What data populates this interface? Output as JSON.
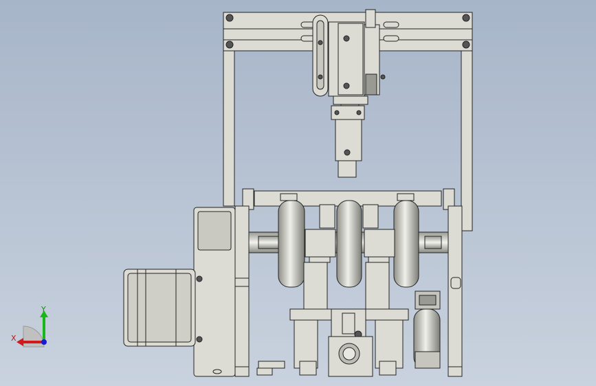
{
  "viewport": {
    "background_top": "#a7b5c9",
    "background_bottom": "#c9d2de",
    "part_color": "#dcdcd5",
    "edge_color": "#222222"
  },
  "triad": {
    "x_label": "X",
    "y_label": "Y",
    "x_color": "#d21a1a",
    "y_color": "#18b818",
    "z_color": "#1a1ad2"
  }
}
